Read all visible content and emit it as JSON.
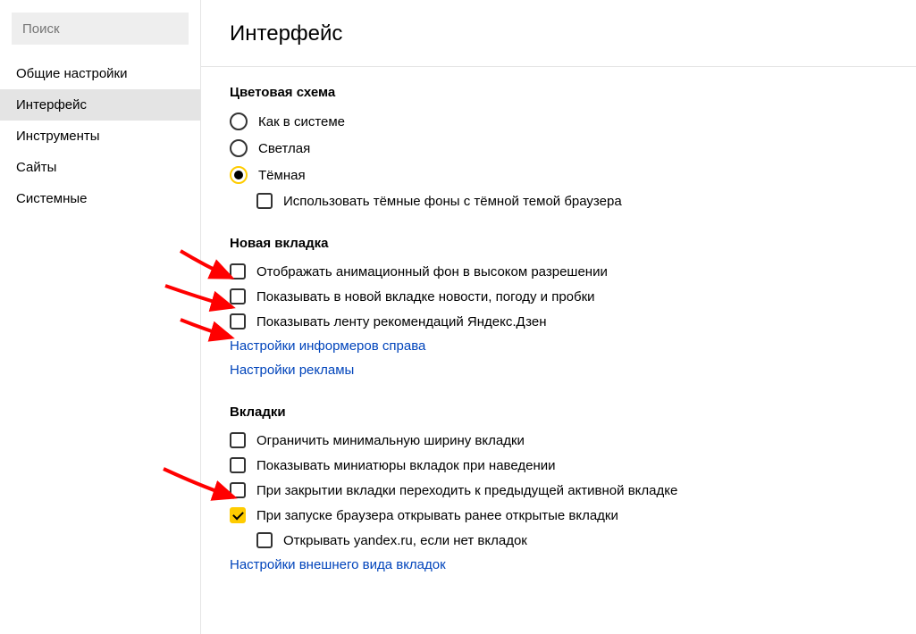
{
  "search": {
    "placeholder": "Поиск"
  },
  "sidebar": {
    "items": [
      {
        "label": "Общие настройки"
      },
      {
        "label": "Интерфейс"
      },
      {
        "label": "Инструменты"
      },
      {
        "label": "Сайты"
      },
      {
        "label": "Системные"
      }
    ]
  },
  "main": {
    "title": "Интерфейс",
    "sections": {
      "color_scheme": {
        "title": "Цветовая схема",
        "radios": [
          {
            "label": "Как в системе"
          },
          {
            "label": "Светлая"
          },
          {
            "label": "Тёмная"
          }
        ],
        "use_dark_bg": "Использовать тёмные фоны с тёмной темой браузера"
      },
      "new_tab": {
        "title": "Новая вкладка",
        "options": [
          {
            "label": "Отображать анимационный фон в высоком разрешении"
          },
          {
            "label": "Показывать в новой вкладке новости, погоду и пробки"
          },
          {
            "label": "Показывать ленту рекомендаций Яндекс.Дзен"
          }
        ],
        "links": [
          "Настройки информеров справа",
          "Настройки рекламы"
        ]
      },
      "tabs": {
        "title": "Вкладки",
        "options": [
          {
            "label": "Ограничить минимальную ширину вкладки"
          },
          {
            "label": "Показывать миниатюры вкладок при наведении"
          },
          {
            "label": "При закрытии вкладки переходить к предыдущей активной вкладке"
          },
          {
            "label": "При запуске браузера открывать ранее открытые вкладки"
          },
          {
            "label": "Открывать yandex.ru, если нет вкладок"
          }
        ],
        "link": "Настройки внешнего вида вкладок"
      }
    }
  }
}
